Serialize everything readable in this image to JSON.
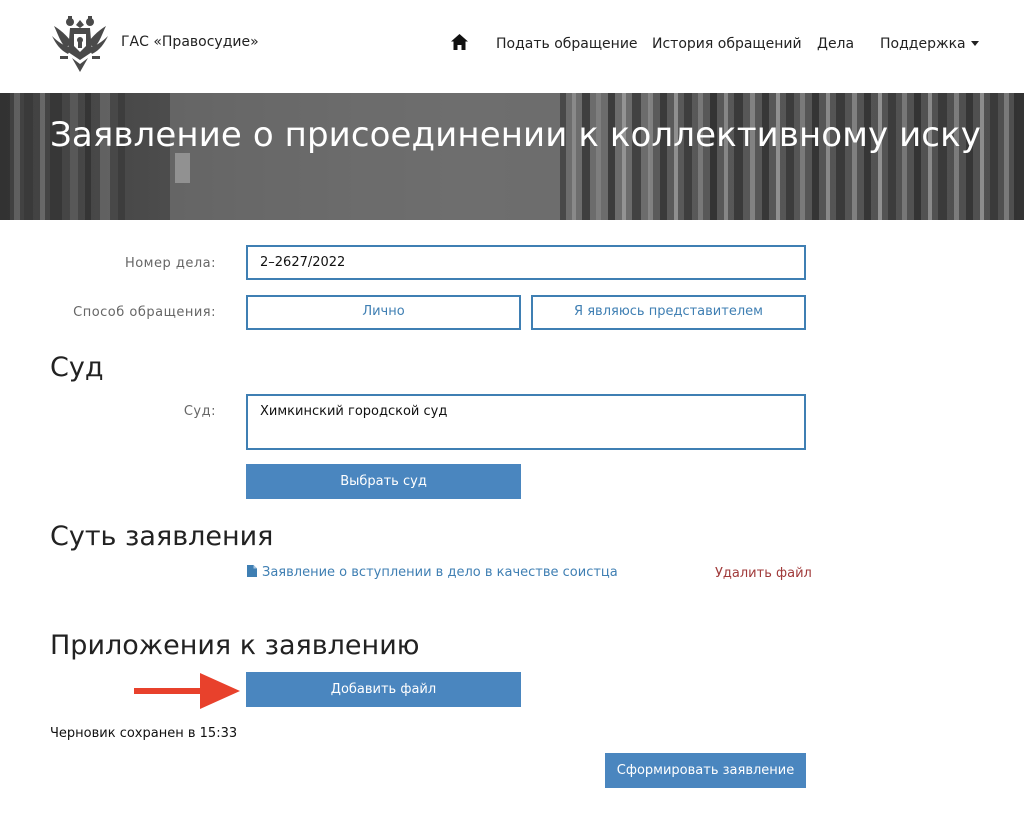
{
  "header": {
    "brand": "ГАС «Правосудие»",
    "home_icon": "home-icon",
    "nav": [
      {
        "label": "Подать обращение"
      },
      {
        "label": "История обращений"
      },
      {
        "label": "Дела"
      },
      {
        "label": "Поддержка",
        "has_dropdown": true
      }
    ]
  },
  "banner": {
    "title": "Заявление о присоединении к коллективному иску"
  },
  "form": {
    "case_number": {
      "label": "Номер дела:",
      "value": "2–2627/2022"
    },
    "appeal_method": {
      "label": "Способ обращения:",
      "options": [
        "Лично",
        "Я являюсь представителем"
      ]
    }
  },
  "court_section": {
    "title": "Суд",
    "court": {
      "label": "Суд:",
      "value": "Химкинский городской суд"
    },
    "select_button": "Выбрать суд"
  },
  "essence_section": {
    "title": "Суть заявления",
    "file_icon": "document-icon",
    "file_name": "Заявление о вступлении в дело в качестве соистца",
    "delete_label": "Удалить файл"
  },
  "attachments_section": {
    "title": "Приложения к заявлению",
    "add_button": "Добавить файл"
  },
  "footer": {
    "draft_status": "Черновик сохранен в 15:33",
    "submit_button": "Сформировать заявление"
  },
  "colors": {
    "accent": "#4a86bf",
    "border": "#3f7fb3",
    "delete": "#a03a3a",
    "annotation_arrow": "#e8412c"
  }
}
